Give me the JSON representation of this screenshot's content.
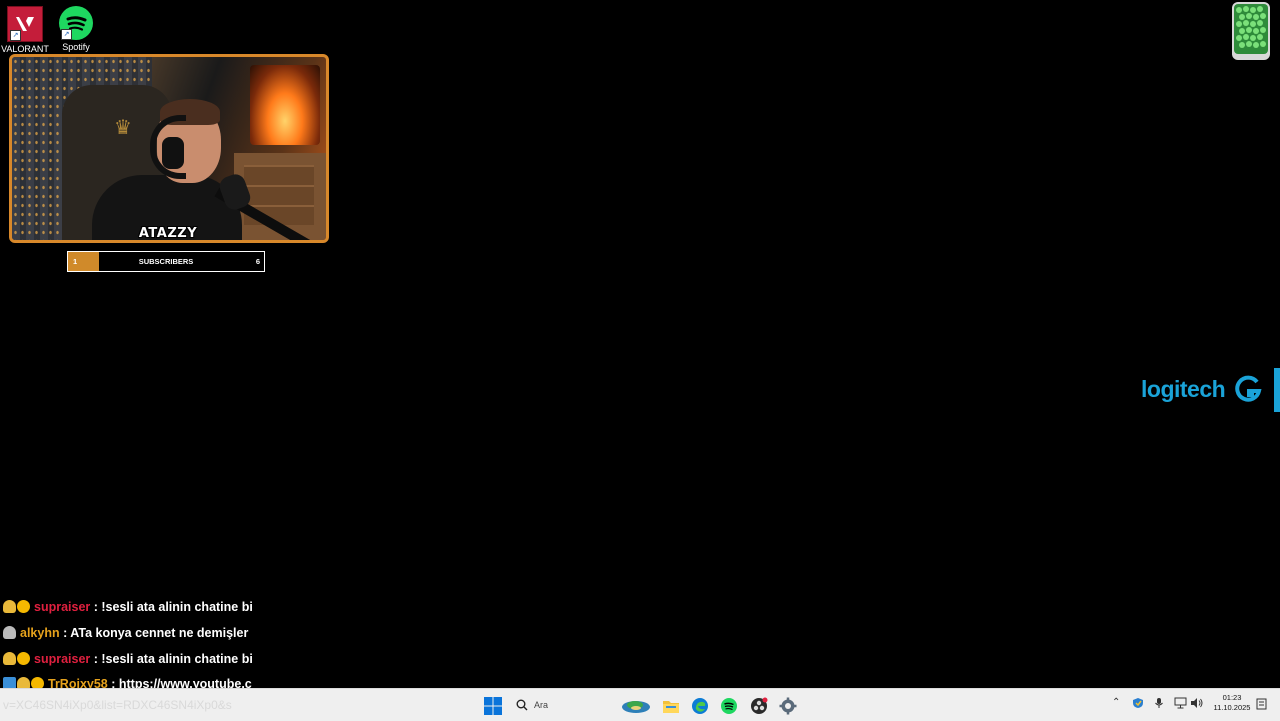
{
  "desktop": {
    "icons": [
      {
        "label": "VALORANT",
        "icon": "valorant-icon"
      },
      {
        "label": "Spotify",
        "icon": "spotify-icon"
      }
    ],
    "recycle_bin_icon": "recycle-bin-icon"
  },
  "webcam": {
    "streamer_name": "ATAZZY"
  },
  "sub_goal": {
    "start": "1",
    "label": "SUBSCRIBERS",
    "end": "6",
    "progress_fraction": 0.16
  },
  "logitech": {
    "brand_text": "logitech",
    "color": "#1aa3d8"
  },
  "chat": [
    {
      "badges": [
        "bell",
        "coin"
      ],
      "user": "supraiser",
      "user_color": "#e0203f",
      "message": "!sesli ata alinin chatine bi"
    },
    {
      "badges": [
        "gray"
      ],
      "user": "alkyhn",
      "user_color": "#e6a21c",
      "message": "ATa konya cennet ne demişler"
    },
    {
      "badges": [
        "bell",
        "coin"
      ],
      "user": "supraiser",
      "user_color": "#e0203f",
      "message": "!sesli ata alinin chatine bi"
    },
    {
      "badges": [
        "blue",
        "bell",
        "coin"
      ],
      "user": "TrRoixy58",
      "user_color": "#e6a21c",
      "message": "https://www.youtube.c"
    }
  ],
  "url_overlay": "v=XC46SN4iXp0&list=RDXC46SN4iXp0&s",
  "taskbar": {
    "search_placeholder": "Ara",
    "apps": [
      "windows-start-icon",
      "widgets-icon",
      "file-explorer-icon",
      "edge-icon",
      "spotify-icon",
      "obs-icon",
      "settings-icon"
    ],
    "tray": {
      "time": "01:23",
      "date": "11.10.2025"
    }
  }
}
